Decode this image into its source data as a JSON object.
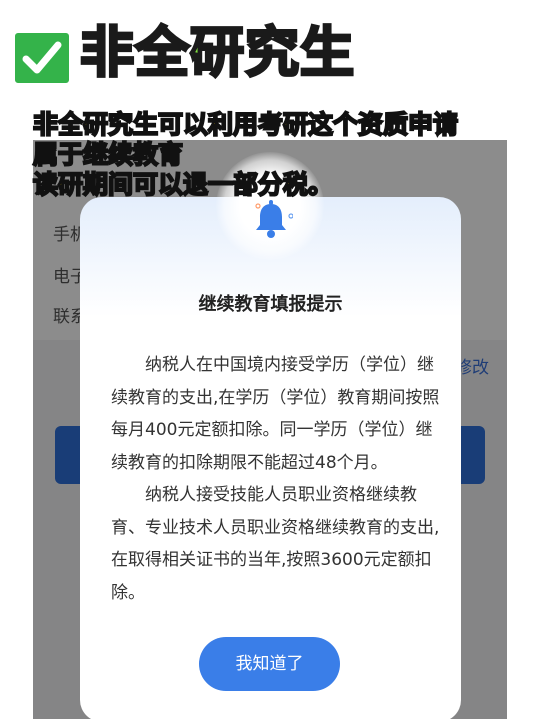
{
  "header": {
    "check_icon": "check-mark-icon",
    "headline": "非全研究生"
  },
  "caption": {
    "line1": "非全研究生可以利用考研这个资质申请",
    "line2": "属于继续教育",
    "line3": "读研期间可以退一部分税。"
  },
  "background_app": {
    "rows": [
      "手机",
      "电子",
      "联系"
    ],
    "modify_label": "修改"
  },
  "dialog": {
    "icon": "bell-icon",
    "title": "继续教育填报提示",
    "paragraph1": "纳税人在中国境内接受学历（学位）继续教育的支出,在学历（学位）教育期间按照每月400元定额扣除。同一学历（学位）继续教育的扣除期限不能超过48个月。",
    "paragraph2": "纳税人接受技能人员职业资格继续教育、专业技术人员职业资格继续教育的支出,在取得相关证书的当年,按照3600元定额扣除。",
    "confirm_label": "我知道了"
  },
  "colors": {
    "primary_blue": "#3a7ee8",
    "headline_green": "#7ee040",
    "caption_yellow": "#ffd600",
    "check_green": "#34b34a"
  }
}
